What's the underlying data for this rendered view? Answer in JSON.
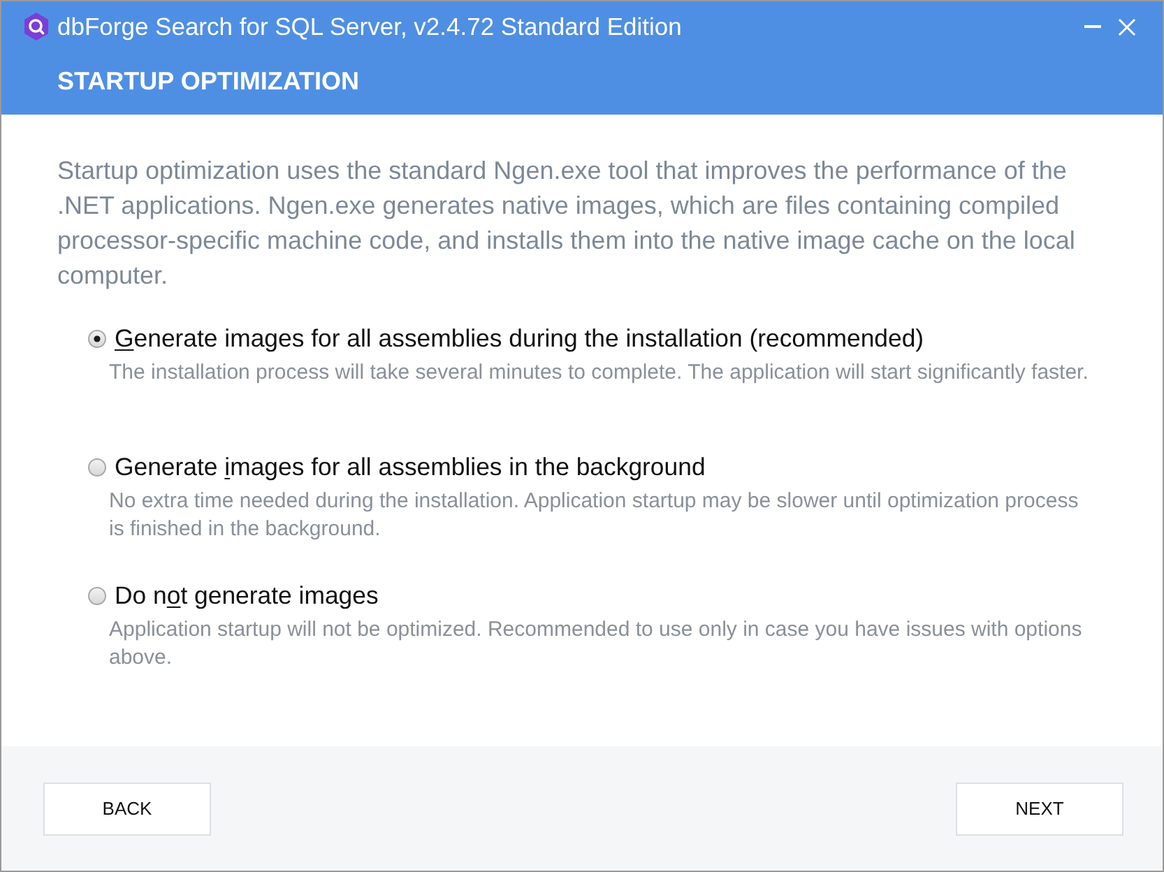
{
  "window": {
    "title": "dbForge Search for SQL Server, v2.4.72 Standard Edition"
  },
  "header": {
    "title": "STARTUP OPTIMIZATION"
  },
  "description": "Startup optimization uses the standard Ngen.exe tool that improves the performance of the .NET applications. Ngen.exe generates native images, which are files containing compiled processor-specific machine code, and installs them into the native image cache on the local computer.",
  "options": [
    {
      "selected": true,
      "label_parts": [
        {
          "text": "G",
          "underlined": true
        },
        {
          "text": "enerate images for all assemblies during the installation (recommended)",
          "underlined": false
        }
      ],
      "hint": "The installation process will take several minutes to complete. The application will start significantly faster."
    },
    {
      "selected": false,
      "label_parts": [
        {
          "text": "Generate ",
          "underlined": false
        },
        {
          "text": "i",
          "underlined": true
        },
        {
          "text": "mages for all assemblies in the background",
          "underlined": false
        }
      ],
      "hint": "No extra time needed during the installation. Application startup may be slower until optimization process is finished in the background."
    },
    {
      "selected": false,
      "label_parts": [
        {
          "text": "Do n",
          "underlined": false
        },
        {
          "text": "o",
          "underlined": true
        },
        {
          "text": "t generate images",
          "underlined": false
        }
      ],
      "hint": "Application startup will not be optimized. Recommended to use only in case you have issues with options above."
    }
  ],
  "buttons": [
    {
      "label": "BACK"
    },
    {
      "label": "NEXT"
    }
  ]
}
